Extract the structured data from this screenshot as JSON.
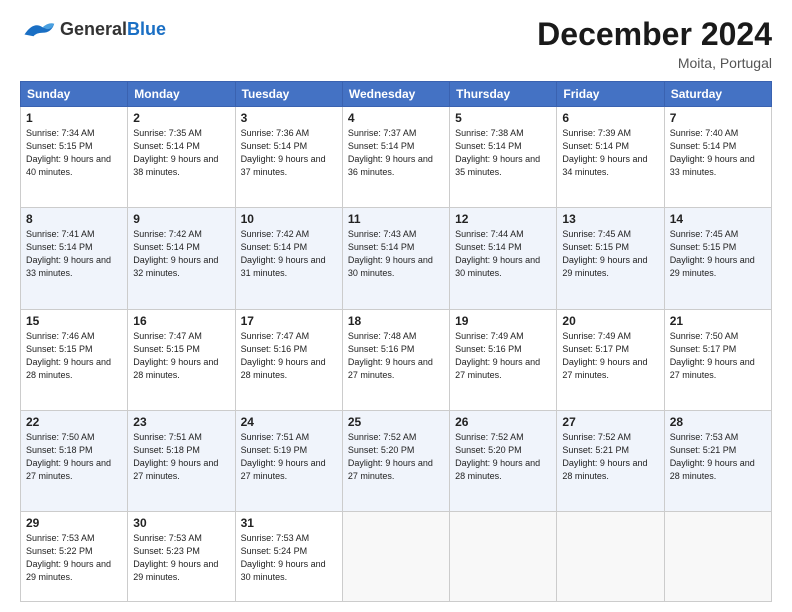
{
  "header": {
    "logo_general": "General",
    "logo_blue": "Blue",
    "month": "December 2024",
    "location": "Moita, Portugal"
  },
  "days_of_week": [
    "Sunday",
    "Monday",
    "Tuesday",
    "Wednesday",
    "Thursday",
    "Friday",
    "Saturday"
  ],
  "weeks": [
    [
      {
        "day": "1",
        "sunrise": "7:34 AM",
        "sunset": "5:15 PM",
        "daylight": "9 hours and 40 minutes."
      },
      {
        "day": "2",
        "sunrise": "7:35 AM",
        "sunset": "5:14 PM",
        "daylight": "9 hours and 38 minutes."
      },
      {
        "day": "3",
        "sunrise": "7:36 AM",
        "sunset": "5:14 PM",
        "daylight": "9 hours and 37 minutes."
      },
      {
        "day": "4",
        "sunrise": "7:37 AM",
        "sunset": "5:14 PM",
        "daylight": "9 hours and 36 minutes."
      },
      {
        "day": "5",
        "sunrise": "7:38 AM",
        "sunset": "5:14 PM",
        "daylight": "9 hours and 35 minutes."
      },
      {
        "day": "6",
        "sunrise": "7:39 AM",
        "sunset": "5:14 PM",
        "daylight": "9 hours and 34 minutes."
      },
      {
        "day": "7",
        "sunrise": "7:40 AM",
        "sunset": "5:14 PM",
        "daylight": "9 hours and 33 minutes."
      }
    ],
    [
      {
        "day": "8",
        "sunrise": "7:41 AM",
        "sunset": "5:14 PM",
        "daylight": "9 hours and 33 minutes."
      },
      {
        "day": "9",
        "sunrise": "7:42 AM",
        "sunset": "5:14 PM",
        "daylight": "9 hours and 32 minutes."
      },
      {
        "day": "10",
        "sunrise": "7:42 AM",
        "sunset": "5:14 PM",
        "daylight": "9 hours and 31 minutes."
      },
      {
        "day": "11",
        "sunrise": "7:43 AM",
        "sunset": "5:14 PM",
        "daylight": "9 hours and 30 minutes."
      },
      {
        "day": "12",
        "sunrise": "7:44 AM",
        "sunset": "5:14 PM",
        "daylight": "9 hours and 30 minutes."
      },
      {
        "day": "13",
        "sunrise": "7:45 AM",
        "sunset": "5:15 PM",
        "daylight": "9 hours and 29 minutes."
      },
      {
        "day": "14",
        "sunrise": "7:45 AM",
        "sunset": "5:15 PM",
        "daylight": "9 hours and 29 minutes."
      }
    ],
    [
      {
        "day": "15",
        "sunrise": "7:46 AM",
        "sunset": "5:15 PM",
        "daylight": "9 hours and 28 minutes."
      },
      {
        "day": "16",
        "sunrise": "7:47 AM",
        "sunset": "5:15 PM",
        "daylight": "9 hours and 28 minutes."
      },
      {
        "day": "17",
        "sunrise": "7:47 AM",
        "sunset": "5:16 PM",
        "daylight": "9 hours and 28 minutes."
      },
      {
        "day": "18",
        "sunrise": "7:48 AM",
        "sunset": "5:16 PM",
        "daylight": "9 hours and 27 minutes."
      },
      {
        "day": "19",
        "sunrise": "7:49 AM",
        "sunset": "5:16 PM",
        "daylight": "9 hours and 27 minutes."
      },
      {
        "day": "20",
        "sunrise": "7:49 AM",
        "sunset": "5:17 PM",
        "daylight": "9 hours and 27 minutes."
      },
      {
        "day": "21",
        "sunrise": "7:50 AM",
        "sunset": "5:17 PM",
        "daylight": "9 hours and 27 minutes."
      }
    ],
    [
      {
        "day": "22",
        "sunrise": "7:50 AM",
        "sunset": "5:18 PM",
        "daylight": "9 hours and 27 minutes."
      },
      {
        "day": "23",
        "sunrise": "7:51 AM",
        "sunset": "5:18 PM",
        "daylight": "9 hours and 27 minutes."
      },
      {
        "day": "24",
        "sunrise": "7:51 AM",
        "sunset": "5:19 PM",
        "daylight": "9 hours and 27 minutes."
      },
      {
        "day": "25",
        "sunrise": "7:52 AM",
        "sunset": "5:20 PM",
        "daylight": "9 hours and 27 minutes."
      },
      {
        "day": "26",
        "sunrise": "7:52 AM",
        "sunset": "5:20 PM",
        "daylight": "9 hours and 28 minutes."
      },
      {
        "day": "27",
        "sunrise": "7:52 AM",
        "sunset": "5:21 PM",
        "daylight": "9 hours and 28 minutes."
      },
      {
        "day": "28",
        "sunrise": "7:53 AM",
        "sunset": "5:21 PM",
        "daylight": "9 hours and 28 minutes."
      }
    ],
    [
      {
        "day": "29",
        "sunrise": "7:53 AM",
        "sunset": "5:22 PM",
        "daylight": "9 hours and 29 minutes."
      },
      {
        "day": "30",
        "sunrise": "7:53 AM",
        "sunset": "5:23 PM",
        "daylight": "9 hours and 29 minutes."
      },
      {
        "day": "31",
        "sunrise": "7:53 AM",
        "sunset": "5:24 PM",
        "daylight": "9 hours and 30 minutes."
      },
      null,
      null,
      null,
      null
    ]
  ]
}
